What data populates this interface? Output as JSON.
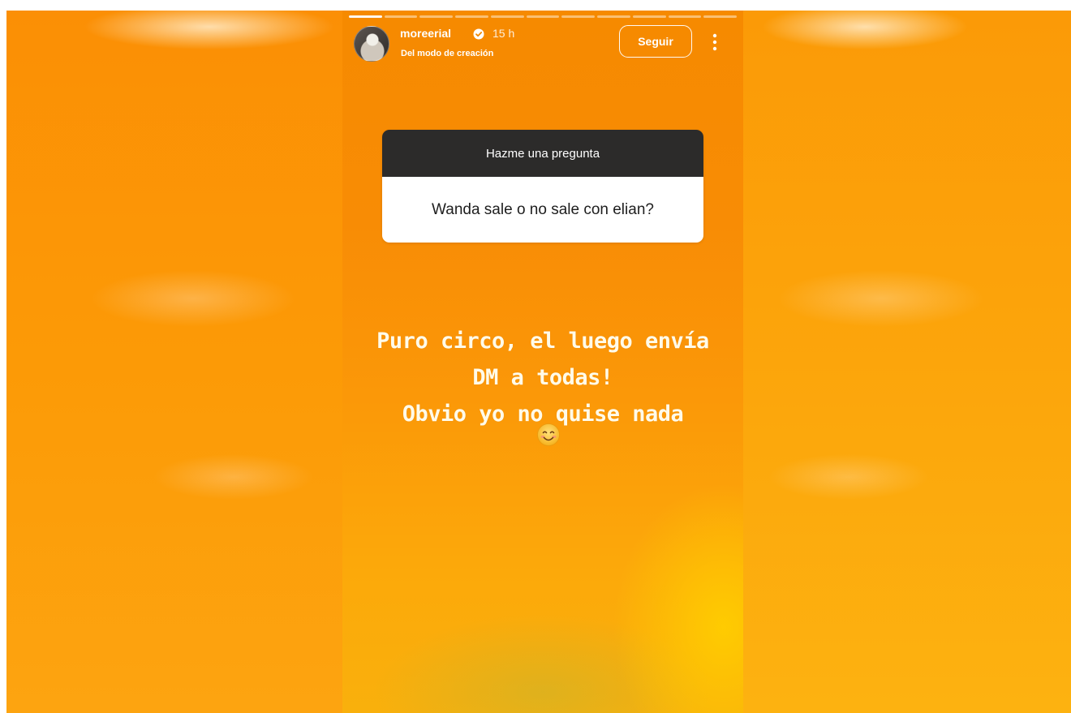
{
  "story": {
    "username": "moreerial",
    "verified": true,
    "time": "15 h",
    "subtitle": "Del modo de creación",
    "follow_label": "Seguir",
    "progress_segments": 11,
    "progress_done": 1,
    "question_sticker": {
      "header": "Hazme una pregunta",
      "question": "Wanda sale o no sale con elian?"
    },
    "caption_lines": [
      "Puro circo, el luego envía",
      "DM a todas!",
      "Obvio yo no quise nada"
    ],
    "emoji_icon": "smiling-face-icon"
  },
  "icons": {
    "verified": "verified-badge-icon",
    "more": "more-options-icon",
    "avatar": "profile-avatar"
  },
  "colors": {
    "story_background": "#f88c05",
    "sticker_header": "#2c2b2a",
    "sticker_body": "#ffffff",
    "caption_text": "#fffbe9"
  }
}
